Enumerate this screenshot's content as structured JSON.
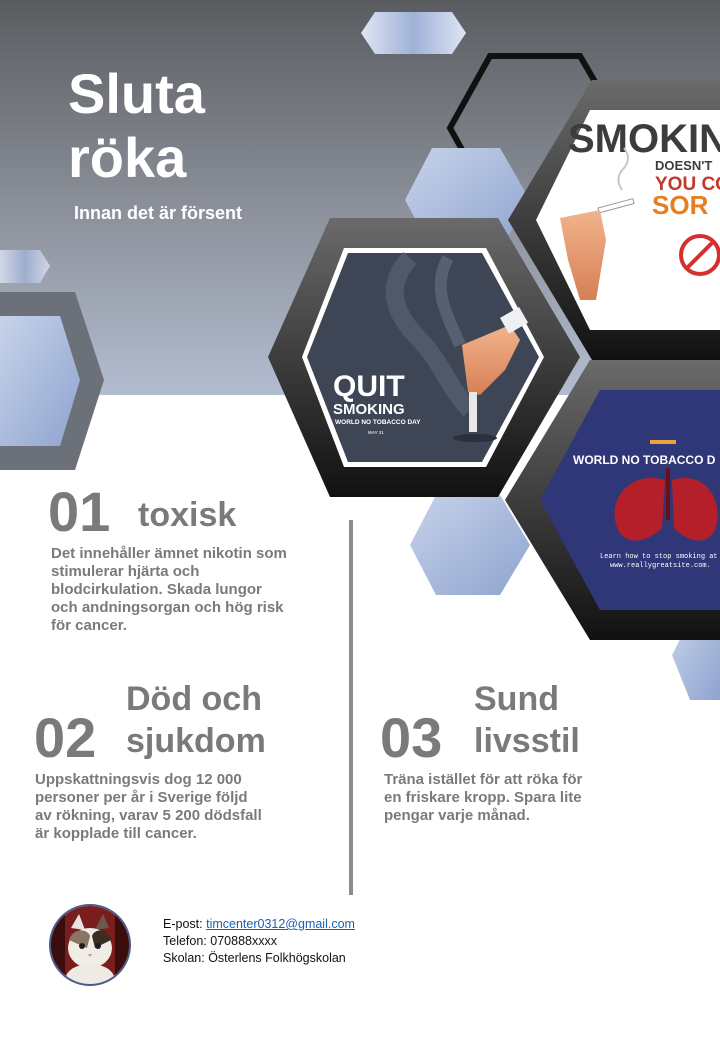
{
  "header": {
    "title_line1": "Sluta",
    "title_line2": "röka",
    "subtitle": "Innan det är försent"
  },
  "images": {
    "quit_smoking": {
      "line1": "QUIT",
      "line2": "SMOKING",
      "line3": "WORLD NO TOBACCO DAY",
      "line4": "MAY 31"
    },
    "smoking_sorry": {
      "line1": "SMOKIN",
      "line2": "DOESN'T",
      "line3": "YOU CO",
      "line4": "SOR"
    },
    "no_tobacco": {
      "line1": "WORLD NO TOBACCO D",
      "line2": "Learn how to stop smoking at",
      "line3": "www.reallygreatsite.com."
    }
  },
  "sections": [
    {
      "number": "01",
      "heading": "toxisk",
      "text": "Det innehåller ämnet nikotin som stimulerar hjärta och blodcirkulation. Skada lungor och andningsorgan och hög risk för cancer."
    },
    {
      "number": "02",
      "heading": "Död och sjukdom",
      "text": "Uppskattningsvis dog 12 000 personer per år i Sverige följd av rökning, varav 5 200 dödsfall är kopplade till cancer."
    },
    {
      "number": "03",
      "heading": "Sund livsstil",
      "text": "Träna istället för att röka för en friskare kropp. Spara lite pengar varje månad."
    }
  ],
  "contact": {
    "email_label": "E-post:",
    "email": "timcenter0312@gmail.com",
    "phone_label": "Telefon:",
    "phone": "070888xxxx",
    "school_label": "Skolan:",
    "school": "Österlens Folkhögskolan"
  },
  "colors": {
    "heading_gray": "#7a7a7a",
    "header_dark": "#5e6166",
    "hex_blue": "#9fb2d8",
    "link": "#1a5fb4"
  }
}
